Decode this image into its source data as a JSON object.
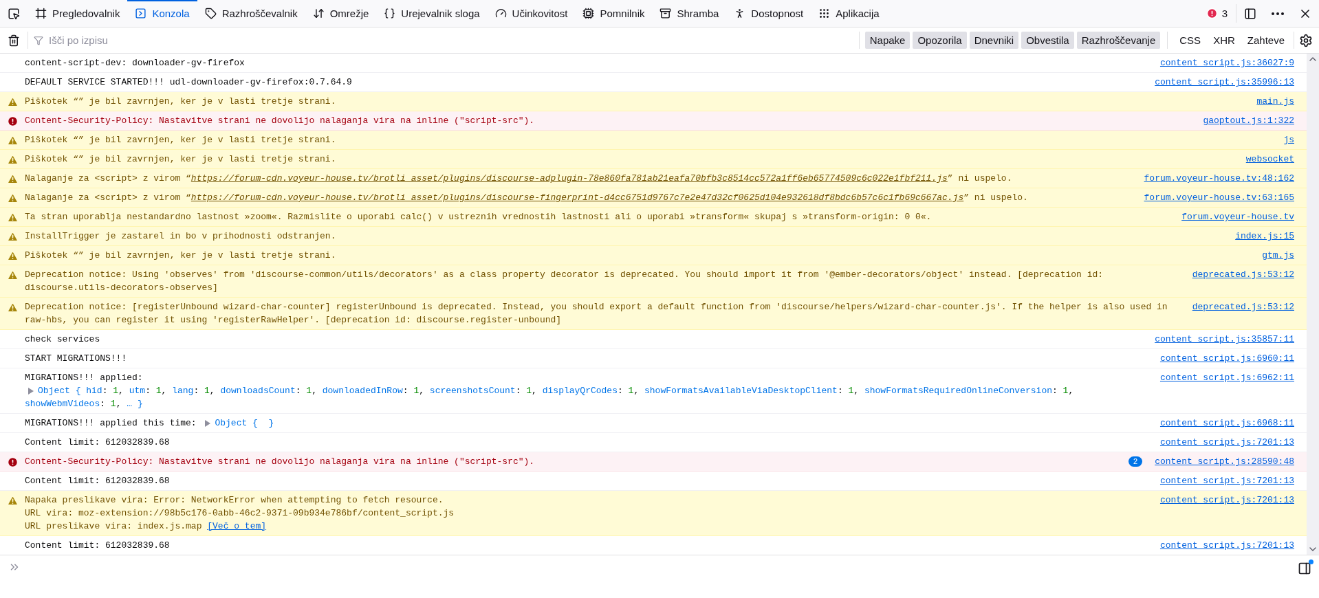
{
  "toolbar": {
    "tabs": [
      {
        "label": "Pregledovalnik",
        "selected": false
      },
      {
        "label": "Konzola",
        "selected": true
      },
      {
        "label": "Razhroščevalnik",
        "selected": false
      },
      {
        "label": "Omrežje",
        "selected": false
      },
      {
        "label": "Urejevalnik sloga",
        "selected": false
      },
      {
        "label": "Učinkovitost",
        "selected": false
      },
      {
        "label": "Pomnilnik",
        "selected": false
      },
      {
        "label": "Shramba",
        "selected": false
      },
      {
        "label": "Dostopnost",
        "selected": false
      },
      {
        "label": "Aplikacija",
        "selected": false
      }
    ],
    "error_count": "3"
  },
  "filter_bar": {
    "placeholder": "Išči po izpisu",
    "levels": [
      {
        "label": "Napake",
        "checked": true
      },
      {
        "label": "Opozorila",
        "checked": true
      },
      {
        "label": "Dnevniki",
        "checked": true
      },
      {
        "label": "Obvestila",
        "checked": true
      },
      {
        "label": "Razhroščevanje",
        "checked": true
      }
    ],
    "extras": [
      {
        "label": "CSS",
        "checked": false
      },
      {
        "label": "XHR",
        "checked": false
      },
      {
        "label": "Zahteve",
        "checked": false
      }
    ]
  },
  "messages": [
    {
      "kind": "log",
      "parts": [
        {
          "kind": "text",
          "text": "content-script-dev: downloader-gv-firefox"
        }
      ],
      "source": "content_script.js:36027:9"
    },
    {
      "kind": "log",
      "parts": [
        {
          "kind": "text",
          "text": "DEFAULT SERVICE STARTED!!! udl-downloader-gv-firefox:0.7.64.9"
        }
      ],
      "source": "content_script.js:35996:13"
    },
    {
      "kind": "warn",
      "parts": [
        {
          "kind": "text",
          "text": "Piškotek “” je bil zavrnjen, ker je v lasti tretje strani."
        }
      ],
      "source": "main.js"
    },
    {
      "kind": "error",
      "parts": [
        {
          "kind": "text",
          "text": "Content-Security-Policy: Nastavitve strani ne dovolijo nalaganja vira na inline (\"script-src\")."
        }
      ],
      "source": "gaoptout.js:1:322"
    },
    {
      "kind": "warn",
      "parts": [
        {
          "kind": "text",
          "text": "Piškotek “” je bil zavrnjen, ker je v lasti tretje strani."
        }
      ],
      "source": "js"
    },
    {
      "kind": "warn",
      "parts": [
        {
          "kind": "text",
          "text": "Piškotek “” je bil zavrnjen, ker je v lasti tretje strani."
        }
      ],
      "source": "websocket"
    },
    {
      "kind": "warn",
      "parts": [
        {
          "kind": "text",
          "text": "Nalaganje za <script> z virom “"
        },
        {
          "kind": "url",
          "text": "https://forum-cdn.voyeur-house.tv/brotli_asset/plugins/discourse-adplugin-78e860fa781ab21eafa70bfb3c8514cc572a1ff6eb65774509c6c022e1fbf211.js"
        },
        {
          "kind": "text",
          "text": "” ni uspelo."
        }
      ],
      "source": "forum.voyeur-house.tv:48:162"
    },
    {
      "kind": "warn",
      "parts": [
        {
          "kind": "text",
          "text": "Nalaganje za <script> z virom “"
        },
        {
          "kind": "url",
          "text": "https://forum-cdn.voyeur-house.tv/brotli_asset/plugins/discourse-fingerprint-d4cc6751d9767c7e2e47d32cf0625d104e932618df8bdc6b57c6c1fb69c667ac.js"
        },
        {
          "kind": "text",
          "text": "” ni uspelo."
        }
      ],
      "source": "forum.voyeur-house.tv:63:165"
    },
    {
      "kind": "warn",
      "parts": [
        {
          "kind": "text",
          "text": "Ta stran uporablja nestandardno lastnost »zoom«. Razmislite o uporabi calc() v ustreznih vrednostih lastnosti ali o uporabi »transform« skupaj s »transform-origin: 0 0«."
        }
      ],
      "source": "forum.voyeur-house.tv"
    },
    {
      "kind": "warn",
      "parts": [
        {
          "kind": "text",
          "text": "InstallTrigger je zastarel in bo v prihodnosti odstranjen."
        }
      ],
      "source": "index.js:15"
    },
    {
      "kind": "warn",
      "parts": [
        {
          "kind": "text",
          "text": "Piškotek “” je bil zavrnjen, ker je v lasti tretje strani."
        }
      ],
      "source": "gtm.js"
    },
    {
      "kind": "warn",
      "parts": [
        {
          "kind": "text",
          "text": "Deprecation notice: Using 'observes' from 'discourse-common/utils/decorators' as a class property decorator is deprecated. You should import it from '@ember-decorators/object' instead. [deprecation id: discourse.utils-decorators-observes]"
        }
      ],
      "source": "deprecated.js:53:12"
    },
    {
      "kind": "warn",
      "parts": [
        {
          "kind": "text",
          "text": "Deprecation notice: [registerUnbound wizard-char-counter] registerUnbound is deprecated. Instead, you should export a default function from 'discourse/helpers/wizard-char-counter.js'. If the helper is also used in raw-hbs, you can register it using 'registerRawHelper'. [deprecation id: discourse.register-unbound]"
        }
      ],
      "source": "deprecated.js:53:12"
    },
    {
      "kind": "log",
      "parts": [
        {
          "kind": "text",
          "text": "check services"
        }
      ],
      "source": "content_script.js:35857:11"
    },
    {
      "kind": "log",
      "parts": [
        {
          "kind": "text",
          "text": "START MIGRATIONS!!!"
        }
      ],
      "source": "content_script.js:6960:11"
    },
    {
      "kind": "log",
      "parts": [
        {
          "kind": "text",
          "text": "MIGRATIONS!!! applied:\n"
        },
        {
          "kind": "object",
          "expanded": false,
          "label": "Object",
          "open": "{",
          "close": "}",
          "separator": ":",
          "delimiter": ",",
          "more": "…",
          "entries": [
            {
              "key": "hid",
              "value": "1"
            },
            {
              "key": "utm",
              "value": "1"
            },
            {
              "key": "lang",
              "value": "1"
            },
            {
              "key": "downloadsCount",
              "value": "1"
            },
            {
              "key": "downloadedInRow",
              "value": "1"
            },
            {
              "key": "screenshotsCount",
              "value": "1"
            },
            {
              "key": "displayQrCodes",
              "value": "1"
            },
            {
              "key": "showFormatsAvailableViaDesktopClient",
              "value": "1"
            },
            {
              "key": "showFormatsRequiredOnlineConversion",
              "value": "1"
            },
            {
              "key": "showWebmVideos",
              "value": "1"
            }
          ]
        }
      ],
      "source": "content_script.js:6962:11"
    },
    {
      "kind": "log",
      "parts": [
        {
          "kind": "text",
          "text": "MIGRATIONS!!! applied this time: "
        },
        {
          "kind": "object",
          "expanded": false,
          "label": "Object",
          "open": "{",
          "close": "}"
        }
      ],
      "source": "content_script.js:6968:11"
    },
    {
      "kind": "log",
      "parts": [
        {
          "kind": "text",
          "text": "Content limit: 612032839.68"
        }
      ],
      "source": "content_script.js:7201:13"
    },
    {
      "kind": "error",
      "parts": [
        {
          "kind": "text",
          "text": "Content-Security-Policy: Nastavitve strani ne dovolijo nalaganja vira na inline (\"script-src\")."
        }
      ],
      "repeat": "2",
      "source": "content_script.js:28590:48"
    },
    {
      "kind": "log",
      "parts": [
        {
          "kind": "text",
          "text": "Content limit: 612032839.68"
        }
      ],
      "source": "content_script.js:7201:13"
    },
    {
      "kind": "warn",
      "parts": [
        {
          "kind": "text",
          "text": "Napaka preslikave vira: Error: NetworkError when attempting to fetch resource.\nURL vira: moz-extension://98b5c176-0abb-46c2-9371-09b934e786bf/content_script.js\nURL preslikave vira: index.js.map "
        },
        {
          "kind": "link",
          "text": "[Več o tem]"
        }
      ],
      "source": "content_script.js:7201:13"
    },
    {
      "kind": "log",
      "parts": [
        {
          "kind": "text",
          "text": "Content limit: 612032839.68"
        }
      ],
      "source": "content_script.js:7201:13"
    }
  ]
}
